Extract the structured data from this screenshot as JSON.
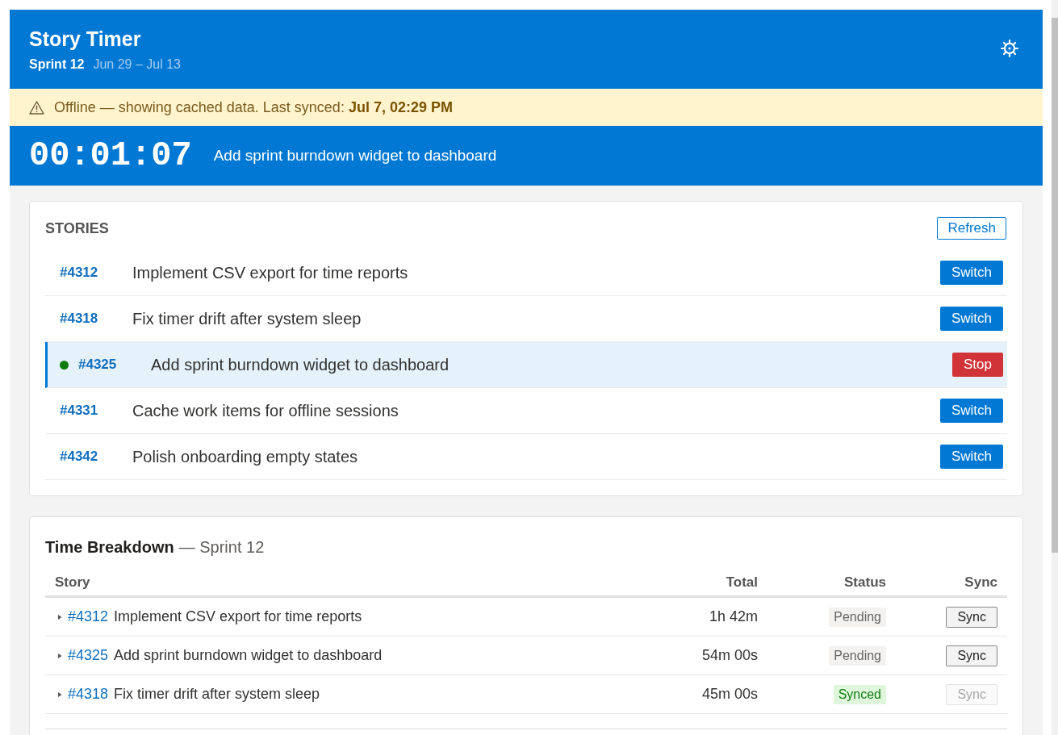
{
  "header": {
    "title": "Story Timer",
    "sprint": "Sprint 12",
    "dates": "Jun 29 – Jul 13"
  },
  "offline_banner": {
    "message": "Offline — showing cached data. Last synced: **Jul 7, 02:29 PM**"
  },
  "timer": {
    "elapsed": "00:01:07",
    "story_title": "Add sprint burndown widget to dashboard"
  },
  "stories": {
    "heading": "STORIES",
    "refresh_label": "Refresh",
    "items": [
      {
        "id": "#4312",
        "title": "Implement CSV export for time reports",
        "selected": false,
        "action": "Switch"
      },
      {
        "id": "#4318",
        "title": "Fix timer drift after system sleep",
        "selected": false,
        "action": "Switch"
      },
      {
        "id": "#4325",
        "title": "Add sprint burndown widget to dashboard",
        "selected": true,
        "action": "Stop"
      },
      {
        "id": "#4331",
        "title": "Cache work items for offline sessions",
        "selected": false,
        "action": "Switch"
      },
      {
        "id": "#4342",
        "title": "Polish onboarding empty states",
        "selected": false,
        "action": "Switch"
      }
    ]
  },
  "breakdown": {
    "title": "Time Breakdown",
    "subtitle": "— Sprint 12",
    "columns": [
      "Story",
      "Total",
      "Status",
      "Sync"
    ],
    "rows": [
      {
        "id": "#4312",
        "title": "Implement CSV export for time reports",
        "expanded": false,
        "total": "1h 42m",
        "status": "Pending",
        "synced": false,
        "sync_label": "Sync",
        "sync_disabled": false
      },
      {
        "id": "#4325",
        "title": "Add sprint burndown widget to dashboard",
        "expanded": false,
        "total": "54m 00s",
        "status": "Pending",
        "synced": false,
        "sync_label": "Sync",
        "sync_disabled": false
      },
      {
        "id": "#4318",
        "title": "Fix timer drift after system sleep",
        "expanded": false,
        "total": "45m 00s",
        "status": "Synced",
        "synced": true,
        "sync_label": "Sync",
        "sync_disabled": true
      }
    ]
  }
}
